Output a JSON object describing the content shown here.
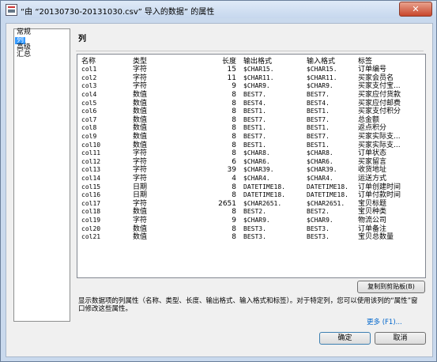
{
  "window": {
    "title": "“由 “20130730-20131030.csv” 导入的数据” 的属性",
    "close": "✕"
  },
  "nav": {
    "items": [
      "常规",
      "列",
      "高级",
      "汇总"
    ],
    "selected": 1
  },
  "section_title": "列",
  "table": {
    "columns": [
      "名称",
      "类型",
      "长度",
      "输出格式",
      "输入格式",
      "标签"
    ],
    "rows": [
      [
        "col1",
        "字符",
        "15",
        "$CHAR15.",
        "$CHAR15.",
        "订单编号"
      ],
      [
        "col2",
        "字符",
        "11",
        "$CHAR11.",
        "$CHAR11.",
        "买家会员名"
      ],
      [
        "col3",
        "字符",
        "9",
        "$CHAR9.",
        "$CHAR9.",
        "买家支付宝..."
      ],
      [
        "col4",
        "数值",
        "8",
        "BEST7.",
        "BEST7.",
        "买家应付货款"
      ],
      [
        "col5",
        "数值",
        "8",
        "BEST4.",
        "BEST4.",
        "买家应付邮费"
      ],
      [
        "col6",
        "数值",
        "8",
        "BEST1.",
        "BEST1.",
        "买家支付积分"
      ],
      [
        "col7",
        "数值",
        "8",
        "BEST7.",
        "BEST7.",
        "总金额"
      ],
      [
        "col8",
        "数值",
        "8",
        "BEST1.",
        "BEST1.",
        "返点积分"
      ],
      [
        "col9",
        "数值",
        "8",
        "BEST7.",
        "BEST7.",
        "买家实际支..."
      ],
      [
        "col10",
        "数值",
        "8",
        "BEST1.",
        "BEST1.",
        "买家实际支..."
      ],
      [
        "col11",
        "字符",
        "8",
        "$CHAR8.",
        "$CHAR8.",
        "订单状态"
      ],
      [
        "col12",
        "字符",
        "6",
        "$CHAR6.",
        "$CHAR6.",
        "买家留言"
      ],
      [
        "col13",
        "字符",
        "39",
        "$CHAR39.",
        "$CHAR39.",
        "收货地址"
      ],
      [
        "col14",
        "字符",
        "4",
        "$CHAR4.",
        "$CHAR4.",
        "运送方式"
      ],
      [
        "col15",
        "日期",
        "8",
        "DATETIME18.",
        "DATETIME18.",
        "订单创建时间"
      ],
      [
        "col16",
        "日期",
        "8",
        "DATETIME18.",
        "DATETIME18.",
        "订单付款时间"
      ],
      [
        "col17",
        "字符",
        "2651",
        "$CHAR2651.",
        "$CHAR2651.",
        "宝贝标题"
      ],
      [
        "col18",
        "数值",
        "8",
        "BEST2.",
        "BEST2.",
        "宝贝种类"
      ],
      [
        "col19",
        "字符",
        "9",
        "$CHAR9.",
        "$CHAR9.",
        "物流公司"
      ],
      [
        "col20",
        "数值",
        "8",
        "BEST3.",
        "BEST3.",
        "订单备注"
      ],
      [
        "col21",
        "数值",
        "8",
        "BEST3.",
        "BEST3.",
        "宝贝总数量"
      ]
    ]
  },
  "copy_button": "复制到剪贴板(B)",
  "description": "显示数据项的列属性（名称、类型、长度、输出格式、输入格式和标签）。对于特定列，您可以使用该列的“属性”窗口修改这些属性。",
  "more_link": "更多 (F1)...",
  "buttons": {
    "ok": "确定",
    "cancel": "取消"
  }
}
